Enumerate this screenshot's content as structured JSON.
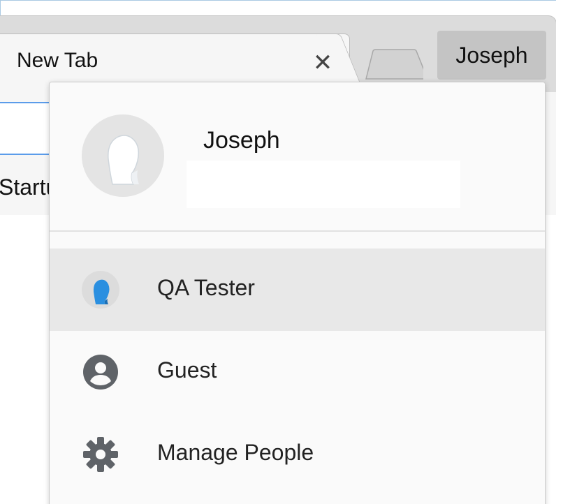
{
  "browser": {
    "tab": {
      "title": "New Tab",
      "close_glyph": "✕"
    },
    "profile_button_label": "Joseph",
    "bookmark_bar_fragment": "Startu"
  },
  "profile_menu": {
    "user_name": "Joseph",
    "items": [
      {
        "label": "QA Tester",
        "icon": "user-avatar-blue-icon",
        "highlighted": true
      },
      {
        "label": "Guest",
        "icon": "account-circle-icon",
        "highlighted": false
      },
      {
        "label": "Manage People",
        "icon": "gear-icon",
        "highlighted": false
      }
    ]
  },
  "colors": {
    "accent_blue": "#5b9cea",
    "avatar_blue": "#2a8fe0",
    "icon_gray": "#5f6368",
    "highlight": "#e8e8e8"
  }
}
